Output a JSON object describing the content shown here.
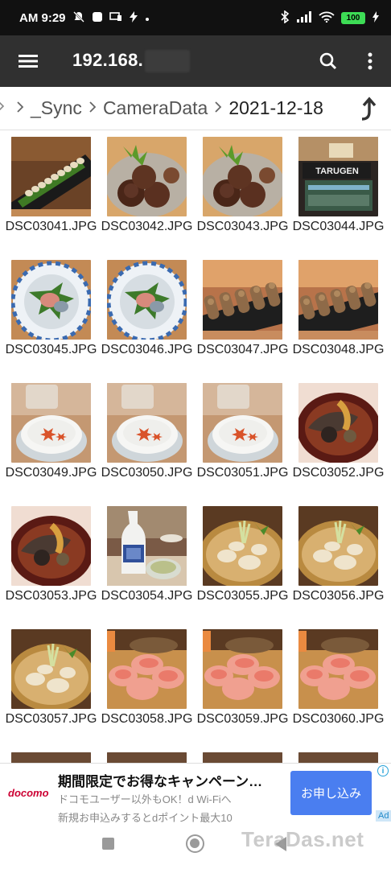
{
  "status_bar": {
    "time": "AM 9:29",
    "battery": "100"
  },
  "app_bar": {
    "title": "192.168."
  },
  "breadcrumb": {
    "items": [
      "_Sync",
      "CameraData",
      "2021-12-18"
    ]
  },
  "files": [
    {
      "name": "DSC03041.JPG",
      "thumb": "asparagus"
    },
    {
      "name": "DSC03042.JPG",
      "thumb": "shiitake"
    },
    {
      "name": "DSC03043.JPG",
      "thumb": "shiitake"
    },
    {
      "name": "DSC03044.JPG",
      "thumb": "storefront"
    },
    {
      "name": "DSC03045.JPG",
      "thumb": "sashimi-bowl"
    },
    {
      "name": "DSC03046.JPG",
      "thumb": "sashimi-bowl"
    },
    {
      "name": "DSC03047.JPG",
      "thumb": "yakitori"
    },
    {
      "name": "DSC03048.JPG",
      "thumb": "yakitori"
    },
    {
      "name": "DSC03049.JPG",
      "thumb": "sake-cup"
    },
    {
      "name": "DSC03050.JPG",
      "thumb": "sake-cup"
    },
    {
      "name": "DSC03051.JPG",
      "thumb": "sake-cup"
    },
    {
      "name": "DSC03052.JPG",
      "thumb": "simmered-fish"
    },
    {
      "name": "DSC03053.JPG",
      "thumb": "simmered-fish"
    },
    {
      "name": "DSC03054.JPG",
      "thumb": "sake-bottle"
    },
    {
      "name": "DSC03055.JPG",
      "thumb": "mushroom-plate"
    },
    {
      "name": "DSC03056.JPG",
      "thumb": "mushroom-plate"
    },
    {
      "name": "DSC03057.JPG",
      "thumb": "mushroom-plate"
    },
    {
      "name": "DSC03058.JPG",
      "thumb": "tuna-sushi"
    },
    {
      "name": "DSC03059.JPG",
      "thumb": "tuna-sushi"
    },
    {
      "name": "DSC03060.JPG",
      "thumb": "tuna-sushi"
    },
    {
      "name": "",
      "thumb": "dark"
    },
    {
      "name": "",
      "thumb": "dark"
    },
    {
      "name": "",
      "thumb": "dark"
    },
    {
      "name": "",
      "thumb": "dark"
    }
  ],
  "ad": {
    "brand": "docomo",
    "title": "期間限定でお得なキャンペーン…",
    "line1": "ドコモユーザー以外もOK！d Wi-Fiへ",
    "line2": "新規お申込みするとdポイント最大10",
    "cta": "お申し込み",
    "info": "i",
    "tag": "Ad"
  },
  "watermark": "TeraDas.net",
  "colors": {
    "status_bar_bg": "#111111",
    "app_bar_bg": "#303030",
    "ad_button": "#4a7ef0",
    "battery": "#3ddc55"
  }
}
